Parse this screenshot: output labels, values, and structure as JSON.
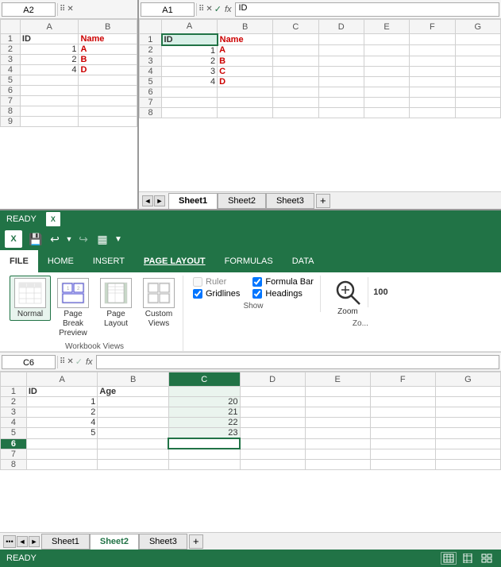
{
  "left_pane": {
    "name_box": "A2",
    "columns": [
      "A",
      "B"
    ],
    "rows": [
      {
        "row": 1,
        "a": "ID",
        "b": "Name",
        "a_class": "cell-id",
        "b_class": "cell-name"
      },
      {
        "row": 2,
        "a": "1",
        "b": "A",
        "a_num": true,
        "b_class": "cell-name"
      },
      {
        "row": 3,
        "a": "2",
        "b": "B",
        "a_num": true,
        "b_class": "cell-name"
      },
      {
        "row": 4,
        "a": "4",
        "b": "D",
        "a_num": true,
        "b_class": "cell-name"
      },
      {
        "row": 5,
        "a": "",
        "b": ""
      },
      {
        "row": 6,
        "a": "",
        "b": ""
      },
      {
        "row": 7,
        "a": "",
        "b": ""
      },
      {
        "row": 8,
        "a": "",
        "b": ""
      },
      {
        "row": 9,
        "a": "",
        "b": ""
      }
    ]
  },
  "top_right_pane": {
    "name_box": "A1",
    "formula_value": "ID",
    "columns": [
      "A",
      "B",
      "C",
      "D",
      "E",
      "F",
      "G"
    ],
    "rows": [
      {
        "row": 1,
        "a": "ID",
        "b": "Name",
        "a_class": "cell-id",
        "b_class": "cell-name"
      },
      {
        "row": 2,
        "a": "1",
        "b": "A",
        "a_num": true,
        "b_class": "cell-name"
      },
      {
        "row": 3,
        "a": "2",
        "b": "B",
        "a_num": true,
        "b_class": "cell-name"
      },
      {
        "row": 4,
        "a": "3",
        "b": "C",
        "a_num": true,
        "b_class": "cell-name"
      },
      {
        "row": 5,
        "a": "4",
        "b": "D",
        "a_num": true,
        "b_class": "cell-name"
      },
      {
        "row": 6,
        "a": "",
        "b": ""
      },
      {
        "row": 7,
        "a": "",
        "b": ""
      },
      {
        "row": 8,
        "a": "",
        "b": ""
      }
    ]
  },
  "top_sheet_tabs": {
    "tabs": [
      "Sheet1",
      "Sheet2",
      "Sheet3"
    ],
    "active": "Sheet1"
  },
  "status_bar_top": {
    "text": "READY"
  },
  "ribbon": {
    "app_name": "READY",
    "tabs": [
      "FILE",
      "HOME",
      "INSERT",
      "PAGE LAYOUT",
      "FORMULAS",
      "DATA"
    ],
    "active_tab": "PAGE LAYOUT",
    "workbook_views": {
      "label": "Workbook Views",
      "buttons": [
        {
          "id": "normal",
          "label": "Normal",
          "active": true
        },
        {
          "id": "page-break",
          "label": "Page Break\nPreview"
        },
        {
          "id": "page-layout",
          "label": "Page\nLayout"
        },
        {
          "id": "custom-views",
          "label": "Custom\nViews"
        }
      ]
    },
    "show": {
      "label": "Show",
      "ruler": {
        "label": "Ruler",
        "checked": false
      },
      "gridlines": {
        "label": "Gridlines",
        "checked": true
      },
      "formula_bar": {
        "label": "Formula Bar",
        "checked": true
      },
      "headings": {
        "label": "Headings",
        "checked": true
      }
    },
    "zoom": {
      "label": "Zoom",
      "percent": "100"
    }
  },
  "bottom_pane": {
    "name_box": "C6",
    "formula_value": "",
    "columns": [
      "A",
      "B",
      "C",
      "D",
      "E",
      "F",
      "G"
    ],
    "rows": [
      {
        "row": 1,
        "a": "ID",
        "b": "Age",
        "a_class": "cell-id",
        "b_class": "cell-id"
      },
      {
        "row": 2,
        "a": "1",
        "b": "",
        "c": "20",
        "a_num": true,
        "c_num": true
      },
      {
        "row": 3,
        "a": "2",
        "b": "",
        "c": "21",
        "a_num": true,
        "c_num": true
      },
      {
        "row": 4,
        "a": "4",
        "b": "",
        "c": "22",
        "a_num": true,
        "c_num": true
      },
      {
        "row": 5,
        "a": "5",
        "b": "",
        "c": "23",
        "a_num": true,
        "c_num": true
      },
      {
        "row": 6,
        "a": "",
        "b": "",
        "c": "",
        "selected": true
      },
      {
        "row": 7,
        "a": "",
        "b": "",
        "c": ""
      },
      {
        "row": 8,
        "a": "",
        "b": "",
        "c": ""
      }
    ]
  },
  "bottom_sheet_tabs": {
    "tabs": [
      "Sheet1",
      "Sheet2",
      "Sheet3"
    ],
    "active": "Sheet2"
  },
  "status_bar_bottom": {
    "text": "READY"
  },
  "icons": {
    "close": "✕",
    "checkmark": "✓",
    "undo": "↩",
    "redo": "↪",
    "save": "💾",
    "fx": "fx",
    "scroll_left": "◄",
    "scroll_right": "►",
    "add": "+",
    "more": "…",
    "grid": "▦",
    "view": "⊞"
  }
}
